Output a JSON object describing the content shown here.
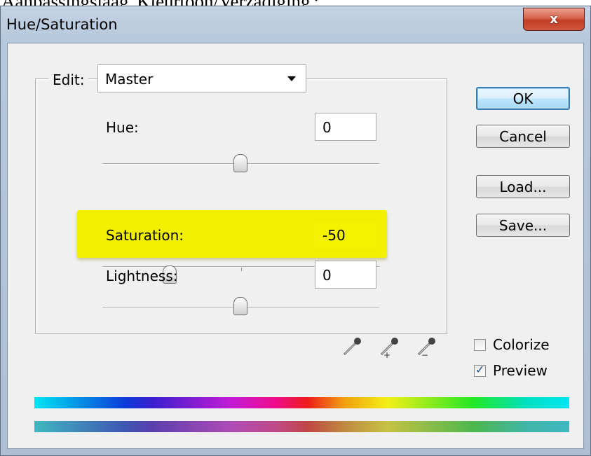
{
  "caption": "Aanpassingslaag 'Kleurtoon/Verzadiging':",
  "window": {
    "title": "Hue/Saturation",
    "close_label": "x"
  },
  "edit": {
    "label": "Edit:",
    "selected": "Master"
  },
  "sliders": {
    "hue": {
      "label": "Hue:",
      "value": "0"
    },
    "saturation": {
      "label": "Saturation:",
      "value": "-50"
    },
    "lightness": {
      "label": "Lightness:",
      "value": "0"
    }
  },
  "buttons": {
    "ok": "OK",
    "cancel": "Cancel",
    "load": "Load...",
    "save": "Save..."
  },
  "checkboxes": {
    "colorize": {
      "label": "Colorize",
      "checked": false
    },
    "preview": {
      "label": "Preview",
      "checked": true
    }
  },
  "icons": [
    "eyedropper-icon",
    "eyedropper-plus-icon",
    "eyedropper-minus-icon"
  ],
  "colors": {
    "highlight": "#f2f000",
    "close_button": "#c13d25",
    "default_button_border": "#3c7fb1"
  }
}
